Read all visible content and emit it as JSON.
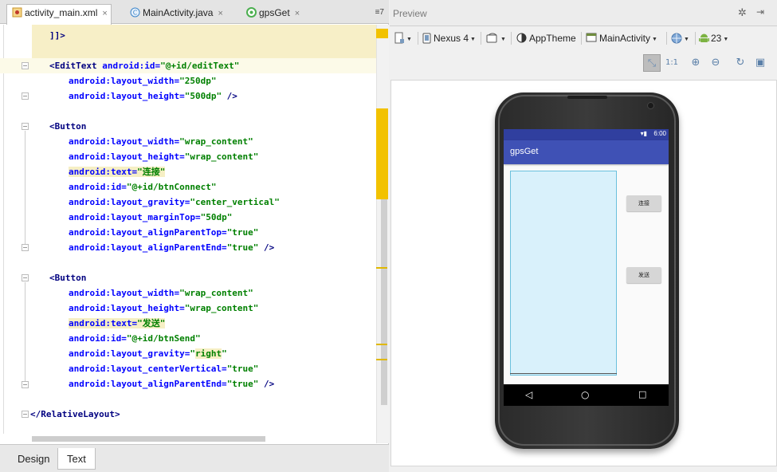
{
  "editor": {
    "tabs": [
      {
        "label": "activity_main.xml",
        "icon": "xml-file-icon",
        "active": true
      },
      {
        "label": "MainActivity.java",
        "icon": "class-file-icon",
        "active": false
      },
      {
        "label": "gpsGet",
        "icon": "android-module-icon",
        "active": false
      }
    ],
    "tab_overflow": "≡7",
    "close_glyph": "×",
    "code": {
      "l0": "]]>",
      "l2a": "<EditText",
      "l2b": " android:id=",
      "l2c": "\"@+id/editText\"",
      "l3a": "android:layout_width=",
      "l3b": "\"250dp\"",
      "l4a": "android:layout_height=",
      "l4b": "\"500dp\"",
      "l4c": " />",
      "l6": "<Button",
      "l7a": "android:layout_width=",
      "l7b": "\"wrap_content\"",
      "l8a": "android:layout_height=",
      "l8b": "\"wrap_content\"",
      "l9a": "android:text=",
      "l9b": "\"连接\"",
      "l10a": "android:id=",
      "l10b": "\"@+id/btnConnect\"",
      "l11a": "android:layout_gravity=",
      "l11b": "\"center_vertical\"",
      "l12a": "android:layout_marginTop=",
      "l12b": "\"50dp\"",
      "l13a": "android:layout_alignParentTop=",
      "l13b": "\"true\"",
      "l14a": "android:layout_alignParentEnd=",
      "l14b": "\"true\"",
      "l14c": " />",
      "l16": "<Button",
      "l17a": "android:layout_width=",
      "l17b": "\"wrap_content\"",
      "l18a": "android:layout_height=",
      "l18b": "\"wrap_content\"",
      "l19a": "android:text=",
      "l19b": "\"发送\"",
      "l20a": "android:id=",
      "l20b": "\"@+id/btnSend\"",
      "l21a": "android:layout_gravity=",
      "l21b1": "\"",
      "l21b2": "right",
      "l21b3": "\"",
      "l22a": "android:layout_centerVertical=",
      "l22b": "\"true\"",
      "l23a": "android:layout_alignParentEnd=",
      "l23b": "\"true\"",
      "l23c": " />",
      "l25": "</RelativeLayout>"
    },
    "bottom_tabs": [
      {
        "label": "Design",
        "active": false
      },
      {
        "label": "Text",
        "active": true
      }
    ]
  },
  "preview": {
    "title": "Preview",
    "toolbar": {
      "device": "Nexus 4",
      "theme": "AppTheme",
      "activity": "MainActivity",
      "api": "23"
    },
    "phone": {
      "status_time": "6:00",
      "app_title": "gpsGet",
      "btn_connect": "连接",
      "btn_send": "发送"
    }
  },
  "colors": {
    "tag": "#000080",
    "attr": "#0000ff",
    "value": "#008000",
    "app_bar": "#3f51b5",
    "status_bar": "#303f9f",
    "scroll_marker": "#f2c200"
  }
}
